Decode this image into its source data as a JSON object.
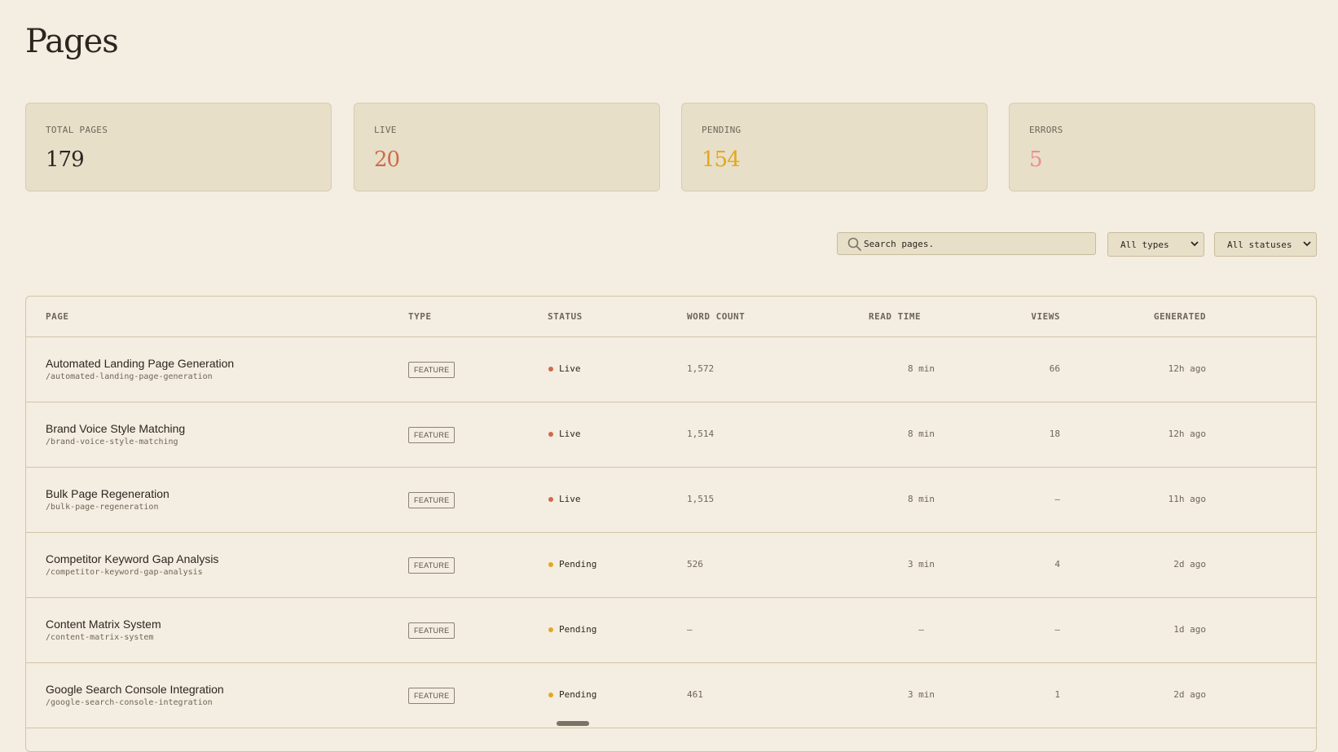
{
  "page": {
    "title": "Pages"
  },
  "stats": [
    {
      "label": "TOTAL PAGES",
      "value": "179",
      "color": "#2b2620"
    },
    {
      "label": "LIVE",
      "value": "20",
      "color": "#cf6b4a"
    },
    {
      "label": "PENDING",
      "value": "154",
      "color": "#e3a81e"
    },
    {
      "label": "ERRORS",
      "value": "5",
      "color": "#ec8f8f"
    }
  ],
  "filters": {
    "search_placeholder": "Search pages.",
    "type_selected": "All types",
    "status_selected": "All statuses"
  },
  "table": {
    "headers": {
      "page": "PAGE",
      "type": "TYPE",
      "status": "STATUS",
      "word_count": "WORD COUNT",
      "read_time": "READ TIME",
      "views": "VIEWS",
      "generated": "GENERATED"
    },
    "rows": [
      {
        "title": "Automated Landing Page Generation",
        "slug": "/automated-landing-page-generation",
        "type": "FEATURE",
        "status": "Live",
        "word_count": "1,572",
        "read_time": "8 min",
        "views": "66",
        "generated": "12h ago"
      },
      {
        "title": "Brand Voice Style Matching",
        "slug": "/brand-voice-style-matching",
        "type": "FEATURE",
        "status": "Live",
        "word_count": "1,514",
        "read_time": "8 min",
        "views": "18",
        "generated": "12h ago"
      },
      {
        "title": "Bulk Page Regeneration",
        "slug": "/bulk-page-regeneration",
        "type": "FEATURE",
        "status": "Live",
        "word_count": "1,515",
        "read_time": "8 min",
        "views": "–",
        "generated": "11h ago"
      },
      {
        "title": "Competitor Keyword Gap Analysis",
        "slug": "/competitor-keyword-gap-analysis",
        "type": "FEATURE",
        "status": "Pending",
        "word_count": "526",
        "read_time": "3 min",
        "views": "4",
        "generated": "2d ago"
      },
      {
        "title": "Content Matrix System",
        "slug": "/content-matrix-system",
        "type": "FEATURE",
        "status": "Pending",
        "word_count": "–",
        "read_time": "–",
        "views": "–",
        "generated": "1d ago"
      },
      {
        "title": "Google Search Console Integration",
        "slug": "/google-search-console-integration",
        "type": "FEATURE",
        "status": "Pending",
        "word_count": "461",
        "read_time": "3 min",
        "views": "1",
        "generated": "2d ago"
      }
    ]
  },
  "status_colors": {
    "Live": "#cf6b4a",
    "Pending": "#e3a81e"
  },
  "icons": {
    "search": "search-icon",
    "select_chevron": "chevron-down-icon"
  }
}
